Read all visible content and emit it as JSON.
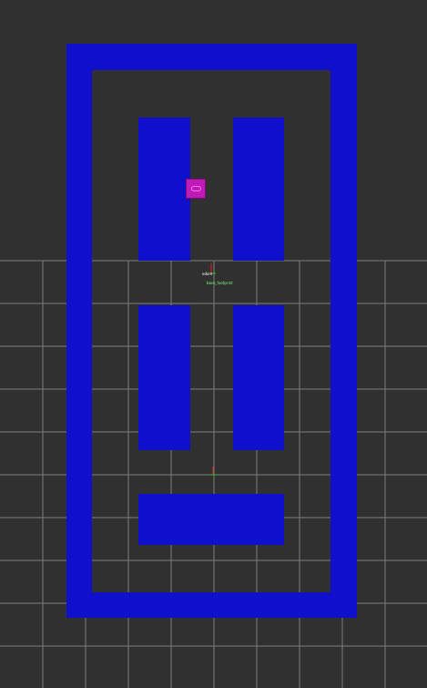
{
  "scene": {
    "background_color": "#303030",
    "grid_color": "#a0a0a0",
    "map_color": "#1010cc",
    "robot_color": "#c01ab8"
  },
  "frames": {
    "origin_label": "odom",
    "origin_sublabel": "base_footprint",
    "odom_axis_icon": "tf-axis-icon",
    "map_axis_icon": "tf-axis-icon"
  },
  "robot": {
    "icon": "robot-marker-icon"
  }
}
